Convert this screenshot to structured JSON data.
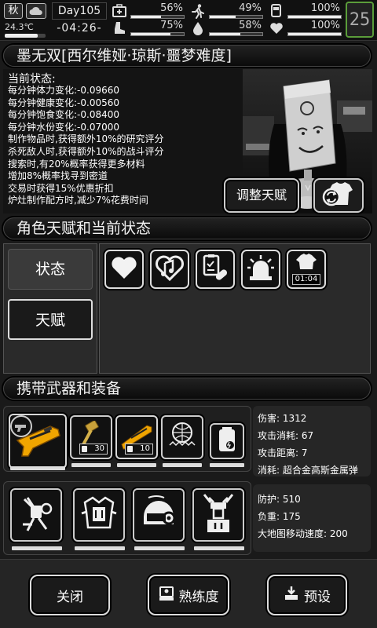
{
  "status_bar": {
    "season": "秋",
    "temperature": "24.3℃",
    "temperature_level": 0.8,
    "day": "Day105",
    "clock": "-04:26-",
    "stats": [
      {
        "name": "health-kit",
        "icon": "medkit-icon",
        "value_text": "56%",
        "level": 0.56
      },
      {
        "name": "stamina",
        "icon": "runner-icon",
        "value_text": "49%",
        "level": 0.49
      },
      {
        "name": "hunger",
        "icon": "bowl-icon",
        "value_text": "100%",
        "level": 1.0
      },
      {
        "name": "hygiene",
        "icon": "boot-icon",
        "value_text": "75%",
        "level": 0.75
      },
      {
        "name": "water",
        "icon": "droplet-icon",
        "value_text": "58%",
        "level": 0.58
      },
      {
        "name": "mood",
        "icon": "heart-icon",
        "value_text": "100%",
        "level": 1.0
      }
    ],
    "pause_label": "25"
  },
  "character": {
    "title": "墨无双[西尔维娅·琼斯·噩梦难度]",
    "stats_title": "当前状态:",
    "stat_lines": [
      "每分钟体力变化:-0.09660",
      "每分钟健康变化:-0.00560",
      "每分钟饱食变化:-0.08400",
      "每分钟水份变化:-0.07000",
      "制作物品时,获得额外10%的研究评分",
      "杀死敌人时,获得额外10%的战斗评分",
      "搜索时,有20%概率获得更多材料",
      "增加8%概率找寻到密道",
      "交易时获得15%优惠折扣",
      "炉灶制作配方时,减少7%花费时间"
    ],
    "adjust_talent_label": "调整天赋"
  },
  "talents": {
    "title": "角色天赋和当前状态",
    "tab_status": "状态",
    "tab_talent": "天赋",
    "effects": [
      {
        "icon": "heart-icon"
      },
      {
        "icon": "music-heart-icon"
      },
      {
        "icon": "medicine-icon"
      },
      {
        "icon": "alarm-light-icon"
      },
      {
        "icon": "shirt-timer-icon",
        "label": "01:04"
      }
    ]
  },
  "equipment": {
    "title": "携带武器和装备",
    "weapons": [
      {
        "icon": "orange-blaster-icon",
        "durability": 1.0
      },
      {
        "icon": "golden-hammer-icon",
        "count": "30",
        "durability": 1.0
      },
      {
        "icon": "orange-rifle-icon",
        "count": "10",
        "durability": 1.0
      },
      {
        "icon": "disco-ball-icon",
        "durability": 1.0
      },
      {
        "icon": "battery-pack-icon",
        "durability": 1.0
      }
    ],
    "weapon_info": [
      "伤害: 1312",
      "攻击消耗: 67",
      "攻击距离: 7",
      "消耗: 超合金高斯金属弹"
    ],
    "gear": [
      {
        "icon": "jetpack-icon",
        "durability": 1.0
      },
      {
        "icon": "armor-vest-icon",
        "durability": 1.0
      },
      {
        "icon": "helmet-icon",
        "durability": 1.0
      },
      {
        "icon": "robot-legs-icon",
        "durability": 1.0
      }
    ],
    "gear_info": [
      "防护: 510",
      "负重: 175",
      "大地图移动速度: 200"
    ]
  },
  "bottom": {
    "close_label": "关闭",
    "proficiency_label": "熟练度",
    "preset_label": "预设"
  }
}
